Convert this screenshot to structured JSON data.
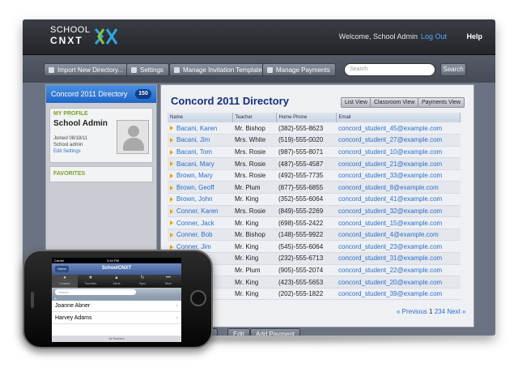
{
  "header": {
    "logo_line1": "SCHOOL",
    "logo_line2": "CNXT",
    "welcome": "Welcome, School Admin",
    "logout": "Log Out",
    "help": "Help"
  },
  "toolbar": {
    "buttons": [
      "Import New Directory...",
      "Settings",
      "Manage Invitation Templates",
      "Manage Payments"
    ],
    "search_placeholder": "Search",
    "search_button": "Search"
  },
  "sidebar": {
    "directory_name": "Concord 2011 Directory",
    "directory_count": "150",
    "profile_title": "MY PROFILE",
    "profile_name": "School Admin",
    "joined": "Joined 08/18/11",
    "role": "School admin",
    "edit_settings": "Edit Settings",
    "favorites": "FAVORITES"
  },
  "main": {
    "title": "Concord 2011 Directory",
    "view_buttons": [
      "List View",
      "Classroom View",
      "Payments View"
    ],
    "columns": [
      "Name",
      "Teacher",
      "Home Phone",
      "Email"
    ],
    "rows": [
      [
        "Bacani, Karen",
        "Mr. Bishop",
        "(382)-555-8623",
        "concord_student_45@example.com"
      ],
      [
        "Bacani, Jim",
        "Mrs. White",
        "(519)-555-0020",
        "concord_student_27@example.com"
      ],
      [
        "Bacani, Tom",
        "Mrs. Rosie",
        "(987)-555-8071",
        "concord_student_10@example.com"
      ],
      [
        "Bacani, Mary",
        "Mrs. Rosie",
        "(487)-555-4587",
        "concord_student_21@example.com"
      ],
      [
        "Brown, Mary",
        "Mrs. Rosie",
        "(492)-555-7735",
        "concord_student_33@example.com"
      ],
      [
        "Brown, Geoff",
        "Mr. Plum",
        "(877)-555-6855",
        "concord_student_8@example.com"
      ],
      [
        "Brown, John",
        "Mr. King",
        "(352)-555-6064",
        "concord_student_41@example.com"
      ],
      [
        "Conner, Karen",
        "Mrs. Rosie",
        "(849)-555-2269",
        "concord_student_32@example.com"
      ],
      [
        "Conner, Jack",
        "Mr. King",
        "(698)-555-2422",
        "concord_student_15@example.com"
      ],
      [
        "Conner, Bob",
        "Mr. Bishop",
        "(148)-555-9922",
        "concord_student_4@example.com"
      ],
      [
        "Conner, Jim",
        "Mr. King",
        "(545)-555-6064",
        "concord_student_23@example.com"
      ],
      [
        "",
        "Mr. King",
        "(232)-555-6713",
        "concord_student_31@example.com"
      ],
      [
        "",
        "Mr. Plum",
        "(905)-555-2074",
        "concord_student_22@example.com"
      ],
      [
        "",
        "Mr. King",
        "(423)-555-5653",
        "concord_student_20@example.com"
      ],
      [
        "",
        "Mr. King",
        "(202)-555-1822",
        "concord_student_39@example.com"
      ]
    ],
    "actions": [
      "ex",
      "Edit",
      "Add Payment"
    ],
    "pager_prev": "« Previous",
    "pager_current": "1",
    "pager_pages": [
      "2",
      "3",
      "4"
    ],
    "pager_next": "Next »"
  },
  "phone": {
    "carrier": "Carrier",
    "time": "3:44 PM",
    "home": "Home",
    "title": "SchoolCNXT",
    "tabs": [
      {
        "label": "Contacts",
        "icon": "contacts-icon"
      },
      {
        "label": "Favorites",
        "icon": "star-icon"
      },
      {
        "label": "Alerts",
        "icon": "alerts-icon"
      },
      {
        "label": "Sync",
        "icon": "sync-icon"
      },
      {
        "label": "More",
        "icon": "more-icon"
      }
    ],
    "search_placeholder": "Search",
    "section": "A",
    "contacts": [
      "Joanne Abner",
      "Harvey Adams"
    ],
    "footer": "All Teachers"
  },
  "colors": {
    "accent_blue": "#2a6fd0",
    "header_dark": "#23252a",
    "green": "#7aa02c"
  }
}
